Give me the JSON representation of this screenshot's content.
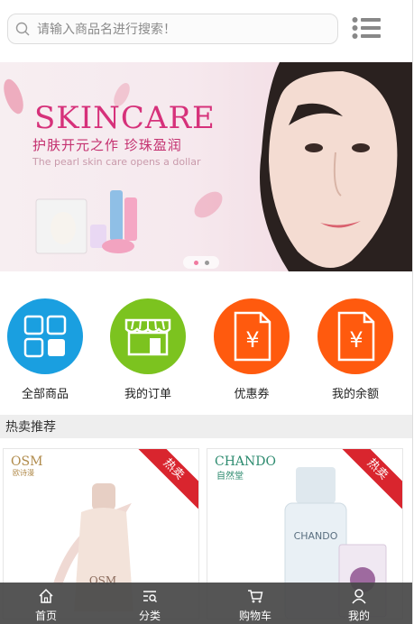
{
  "search": {
    "placeholder": "请输入商品名进行搜索！"
  },
  "banner": {
    "title": "SKINCARE",
    "subtitle": "护肤开元之作 珍珠盈润",
    "tagline": "The pearl skin care opens a dollar",
    "active_slide": 1,
    "slide_count": 2
  },
  "quick_nav": [
    {
      "label": "全部商品",
      "icon": "grid-icon",
      "color": "#1a9fe0"
    },
    {
      "label": "我的订单",
      "icon": "shop-icon",
      "color": "#7cc31f"
    },
    {
      "label": "优惠券",
      "icon": "coupon-yen-icon",
      "color": "#ff5a0e"
    },
    {
      "label": "我的余额",
      "icon": "balance-yen-icon",
      "color": "#ff5a0e"
    }
  ],
  "section": {
    "title": "热卖推荐"
  },
  "products": [
    {
      "brand": "OSM",
      "brand_sub": "欧诗漫",
      "badge": "热卖"
    },
    {
      "brand": "CHANDO",
      "brand_sub": "自然堂",
      "badge": "热卖"
    }
  ],
  "tabbar": [
    {
      "label": "首页",
      "icon": "home-icon"
    },
    {
      "label": "分类",
      "icon": "category-icon"
    },
    {
      "label": "购物车",
      "icon": "cart-icon"
    },
    {
      "label": "我的",
      "icon": "user-icon"
    }
  ]
}
